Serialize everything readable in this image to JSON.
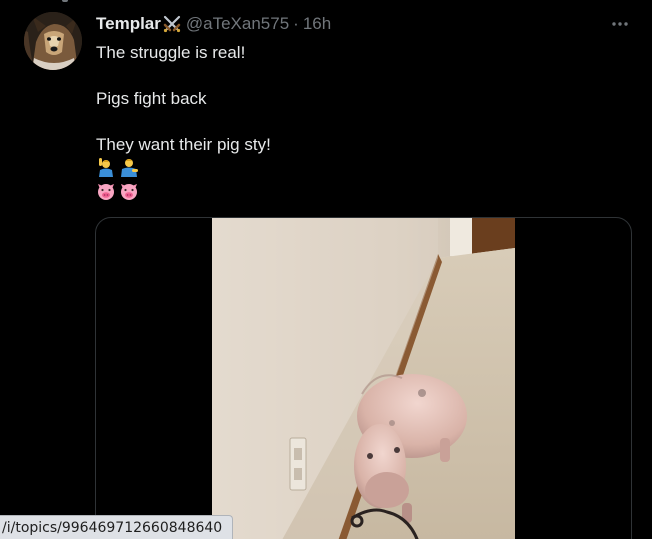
{
  "tweet": {
    "author": {
      "display_name": "Templar",
      "name_icon": "crossed-swords-icon",
      "handle": "@aTeXan575",
      "separator": "·",
      "timestamp": "16h"
    },
    "lines": [
      "The struggle is real!",
      "Pigs fight back",
      "They want their pig sty!"
    ],
    "emoji_rows": [
      [
        "person-raising-hand-emoji",
        "person-tipping-hand-emoji"
      ],
      [
        "pig-face-emoji",
        "pig-face-emoji"
      ]
    ],
    "more_icon": "ellipsis-icon",
    "media": {
      "type": "video",
      "subject": "pig-in-hallway"
    }
  },
  "browser_status": {
    "url": "/i/topics/996469712660848640"
  },
  "colors": {
    "background": "#000000",
    "text_primary": "#e7e9ea",
    "text_secondary": "#71767b",
    "border": "#2f3336",
    "status_bar_bg": "#dee1e6"
  }
}
